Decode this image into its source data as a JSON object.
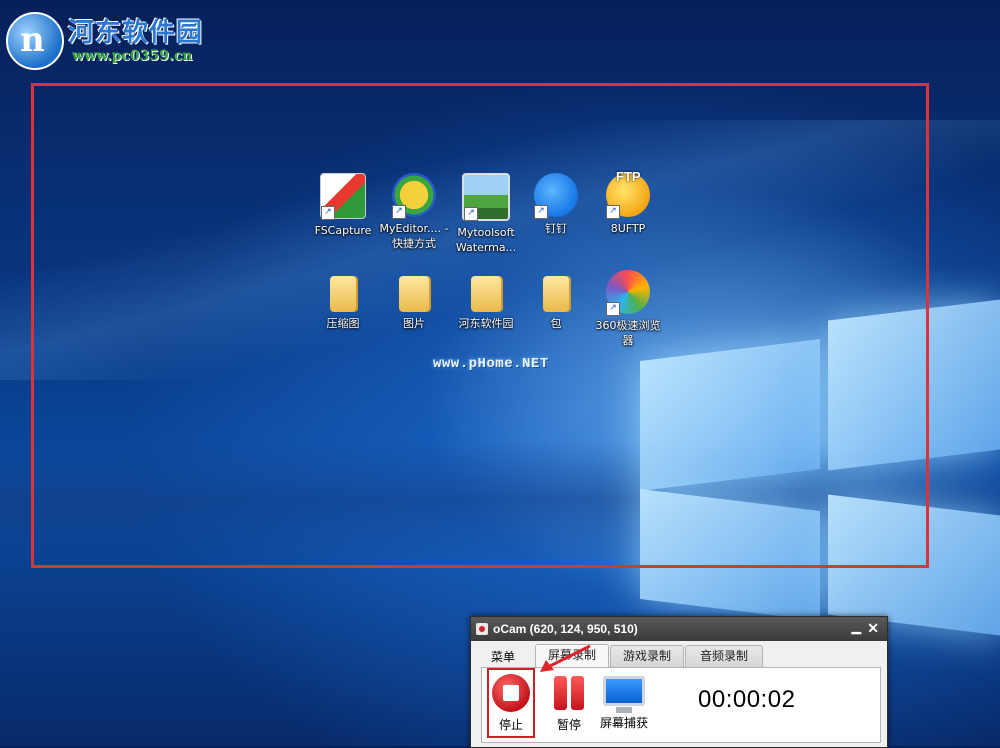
{
  "watermark": {
    "title": "河东软件园",
    "url": "www.pc0359.cn",
    "logo_letter": "n"
  },
  "desktop": {
    "icons_row1": [
      {
        "label": "FSCapture",
        "icon": "fscapture-icon"
      },
      {
        "label": "MyEditor.... - 快捷方式",
        "icon": "myeditor-icon"
      },
      {
        "label": "Mytoolsoft Waterma...",
        "icon": "mytoolsoft-icon"
      },
      {
        "label": "钉钉",
        "icon": "dingtalk-icon"
      },
      {
        "label": "8UFTP",
        "icon": "8uftp-icon",
        "badge": "FTP"
      }
    ],
    "icons_row2": [
      {
        "label": "压缩图",
        "icon": "folder-icon"
      },
      {
        "label": "图片",
        "icon": "folder-icon"
      },
      {
        "label": "河东软件园",
        "icon": "folder-icon"
      },
      {
        "label": "包",
        "icon": "folder-icon"
      },
      {
        "label": "360极速浏览器",
        "icon": "browser-360-icon"
      }
    ],
    "watermark_text": "www.pHome.NET"
  },
  "ocam": {
    "title": "oCam (620, 124, 950, 510)",
    "menu_label": "菜单",
    "tabs": [
      "屏幕录制",
      "游戏录制",
      "音频录制"
    ],
    "active_tab": 0,
    "buttons": {
      "stop": "停止",
      "pause": "暂停",
      "capture": "屏幕捕获"
    },
    "timer": "00:00:02"
  },
  "colors": {
    "capture_border": "#d8343a",
    "stop_highlight": "#d11f25"
  }
}
